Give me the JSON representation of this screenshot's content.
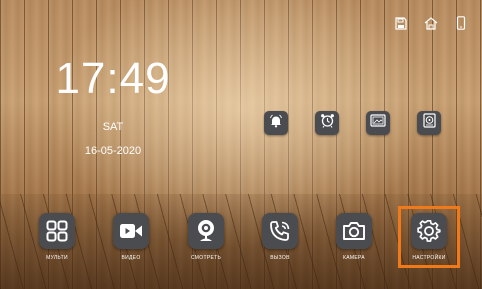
{
  "status_icons": [
    "sd-card-icon",
    "house-icon",
    "phone-icon"
  ],
  "clock": {
    "time": "17:49",
    "day": "SAT",
    "date": "16-05-2020"
  },
  "quick_actions": [
    {
      "icon": "bell-icon"
    },
    {
      "icon": "alarm-clock-icon"
    },
    {
      "icon": "picture-frame-icon"
    },
    {
      "icon": "recorder-icon"
    }
  ],
  "apps": [
    {
      "icon": "grid-icon",
      "label": "МУЛЬТИ"
    },
    {
      "icon": "video-camera-icon",
      "label": "ВИДЕО"
    },
    {
      "icon": "webcam-icon",
      "label": "СМОТРЕТЬ"
    },
    {
      "icon": "phone-call-icon",
      "label": "ВЫЗОВ"
    },
    {
      "icon": "camera-icon",
      "label": "КАМЕРА"
    },
    {
      "icon": "gear-icon",
      "label": "НАСТРОЙКИ"
    }
  ],
  "colors": {
    "accent": "#f07a1a",
    "tile": "#4a4c50"
  }
}
